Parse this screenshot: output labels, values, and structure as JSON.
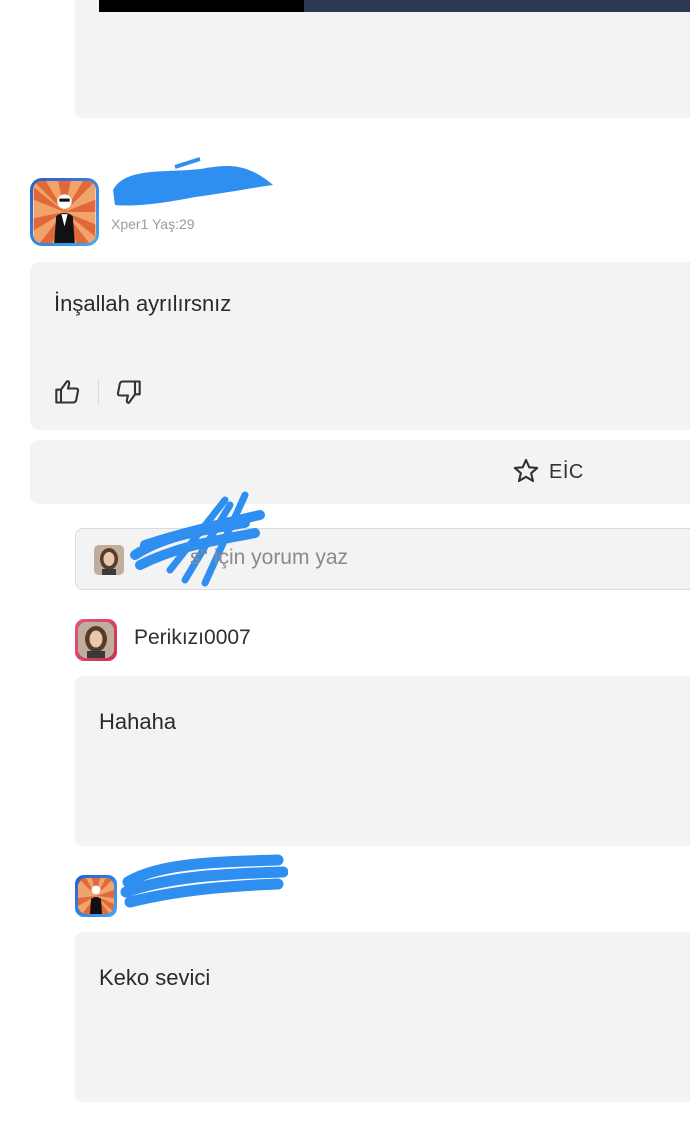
{
  "comment": {
    "meta": "Xper1 Yaş:29",
    "text": "İnşallah ayrılırsnız"
  },
  "actions": {
    "like_icon": "thumbs-up-icon",
    "dislike_icon": "thumbs-down-icon",
    "star_icon": "star-icon",
    "eic_label": "EİC"
  },
  "reply_input": {
    "placeholder_tail": "\" için yorum yaz",
    "placeholder_prefix_fragment": "s"
  },
  "replies": [
    {
      "username": "Perikızı0007",
      "text": "Hahaha"
    },
    {
      "username": "",
      "text": "Keko sevici"
    }
  ],
  "colors": {
    "accent_blue": "#2f8ff0",
    "card_bg": "#f3f3f3",
    "avatar_ring_blue": "#2c5ac9",
    "avatar_ring_pink": "#e05a7a"
  }
}
